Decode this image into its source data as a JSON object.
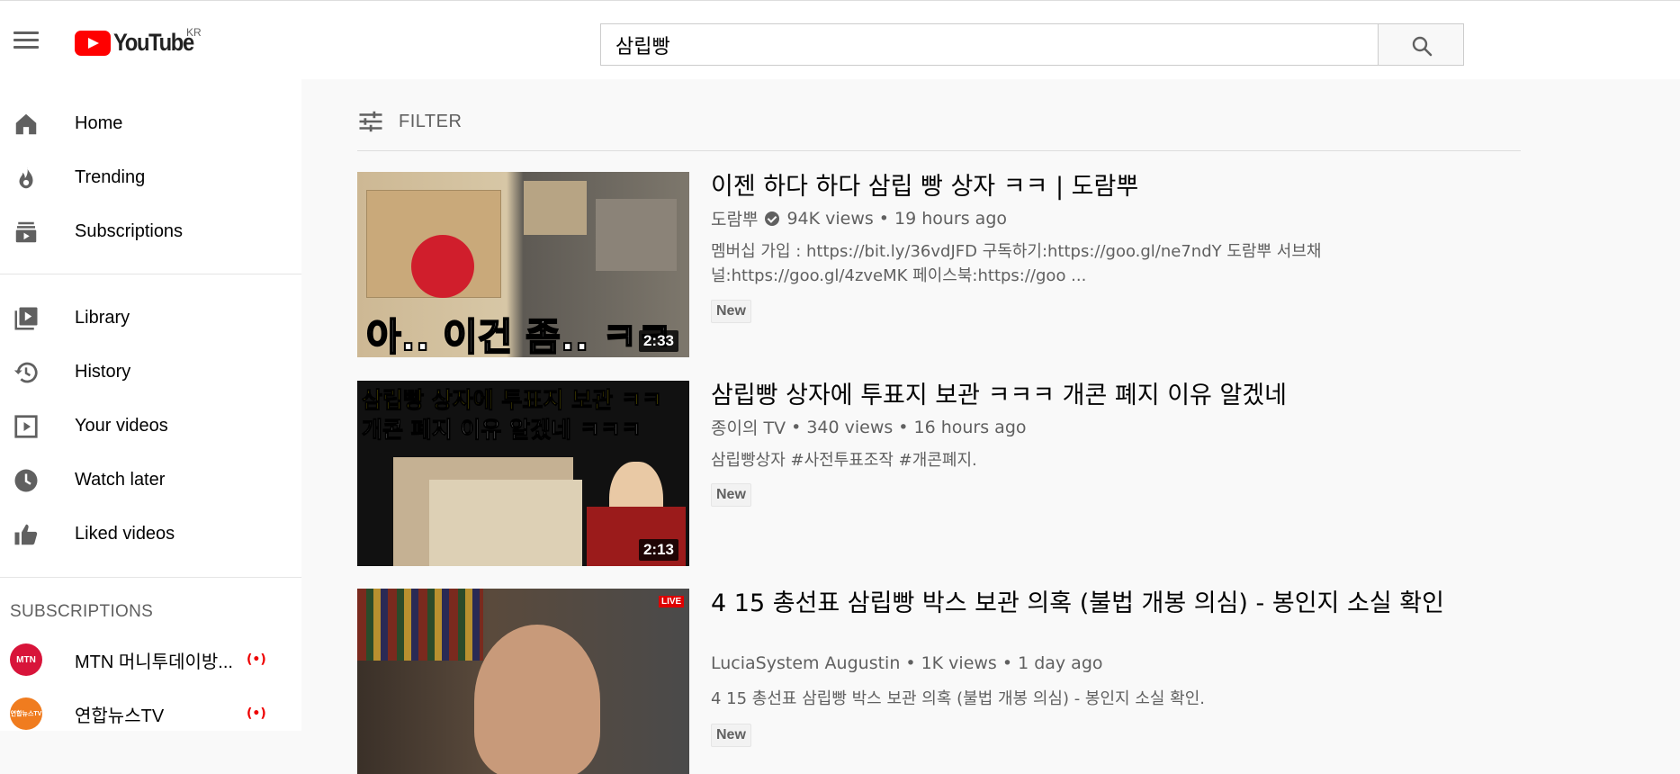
{
  "header": {
    "logo_text": "YouTube",
    "country_code": "KR",
    "search_value": "삼립빵"
  },
  "sidebar": {
    "main_items": [
      {
        "label": "Home",
        "icon": "home-icon"
      },
      {
        "label": "Trending",
        "icon": "trending-icon"
      },
      {
        "label": "Subscriptions",
        "icon": "subscriptions-icon"
      }
    ],
    "library_items": [
      {
        "label": "Library",
        "icon": "library-icon"
      },
      {
        "label": "History",
        "icon": "history-icon"
      },
      {
        "label": "Your videos",
        "icon": "your-videos-icon"
      },
      {
        "label": "Watch later",
        "icon": "watch-later-icon"
      },
      {
        "label": "Liked videos",
        "icon": "liked-videos-icon"
      }
    ],
    "subscriptions_heading": "SUBSCRIPTIONS",
    "subscriptions": [
      {
        "name": "MTN 머니투데이방...",
        "avatar_text": "MTN",
        "avatar_color": "#d8143a",
        "live": "(•)"
      },
      {
        "name": "연합뉴스TV",
        "avatar_text": "연합뉴스TV",
        "avatar_color": "#f07c1f",
        "live": "(•)"
      }
    ]
  },
  "filter": {
    "label": "FILTER"
  },
  "results": [
    {
      "title": "이젠 하다 하다 삼립 빵 상자 ㅋㅋ | 도람뿌",
      "channel": "도람뿌",
      "verified": true,
      "views": "94K views",
      "age": "19 hours ago",
      "description": "멤버십 가입 : https://bit.ly/36vdJFD 구독하기:https://goo.gl/ne7ndY 도람뿌 서브채널:https://goo.gl/4zveMK 페이스북:https://goo ...",
      "badge": "New",
      "duration": "2:33",
      "thumb_caption": "아.. 이건 좀.. ㅋㅋ"
    },
    {
      "title": "삼립빵 상자에 투표지 보관 ㅋㅋㅋ 개콘 폐지 이유 알겠네",
      "channel": "종이의 TV",
      "verified": false,
      "views": "340 views",
      "age": "16 hours ago",
      "description": "삼립빵상자 #사전투표조작 #개콘폐지.",
      "badge": "New",
      "duration": "2:13",
      "thumb_caption_line1": "삼립빵 상자에 투표지 보관 ㅋㅋ",
      "thumb_caption_line2": "개콘 폐지 이유 알겠네 ㅋㅋㅋ"
    },
    {
      "title": "4 15 총선표 삼립빵 박스 보관 의혹 (불법 개봉 의심) - 봉인지 소실 확인",
      "channel": "LuciaSystem Augustin",
      "verified": false,
      "views": "1K views",
      "age": "1 day ago",
      "description": "4 15 총선표 삼립빵 박스 보관 의혹 (불법 개봉 의심) - 봉인지 소실 확인.",
      "badge": "New",
      "duration": "",
      "thumb_caption": "LIVE"
    }
  ],
  "meta_separator": "•"
}
